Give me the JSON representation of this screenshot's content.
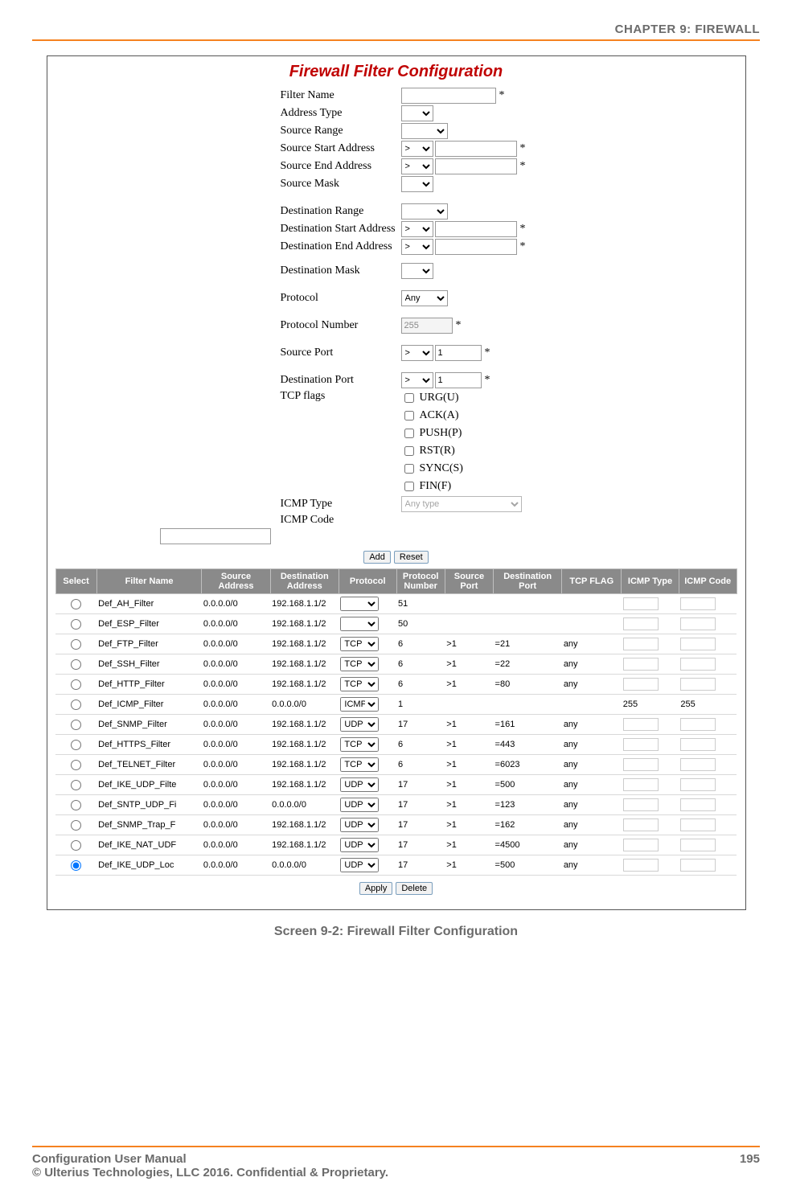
{
  "doc": {
    "chapter_header": "CHAPTER 9: FIREWALL",
    "caption": "Screen 9-2: Firewall Filter Configuration",
    "footer_left_1": "Configuration User Manual",
    "footer_left_2": "© Ulterius Technologies, LLC 2016. Confidential & Proprietary.",
    "page_number": "195"
  },
  "figure": {
    "title": "Firewall Filter Configuration",
    "form": {
      "filter_name_label": "Filter Name",
      "filter_name_value": "",
      "address_type_label": "Address Type",
      "source_range_label": "Source Range",
      "source_start_label": "Source Start Address",
      "source_start_op": ">",
      "source_start_value": "",
      "source_end_label": "Source End Address",
      "source_end_op": ">",
      "source_end_value": "",
      "source_mask_label": "Source Mask",
      "dest_range_label": "Destination Range",
      "dest_start_label": "Destination Start Address",
      "dest_start_op": ">",
      "dest_start_value": "",
      "dest_end_label": "Destination End Address",
      "dest_end_op": ">",
      "dest_end_value": "",
      "dest_mask_label": "Destination Mask",
      "protocol_label": "Protocol",
      "protocol_value": "Any",
      "protocol_number_label": "Protocol Number",
      "protocol_number_value": "255",
      "source_port_label": "Source Port",
      "source_port_op": ">",
      "source_port_value": "1",
      "dest_port_label": "Destination Port",
      "dest_port_op": ">",
      "dest_port_value": "1",
      "tcp_flags_label": "TCP flags",
      "tcp_flags": [
        {
          "key": "urg",
          "label": "URG(U)"
        },
        {
          "key": "ack",
          "label": "ACK(A)"
        },
        {
          "key": "push",
          "label": "PUSH(P)"
        },
        {
          "key": "rst",
          "label": "RST(R)"
        },
        {
          "key": "sync",
          "label": "SYNC(S)"
        },
        {
          "key": "fin",
          "label": "FIN(F)"
        }
      ],
      "icmp_type_label": "ICMP Type",
      "icmp_type_value": "Any type",
      "icmp_code_label": "ICMP Code",
      "icmp_code_value": "",
      "btn_add": "Add",
      "btn_reset": "Reset",
      "btn_apply": "Apply",
      "btn_delete": "Delete"
    },
    "table": {
      "headers": {
        "select": "Select",
        "name": "Filter Name",
        "src": "Source Address",
        "dst": "Destination Address",
        "protocol": "Protocol",
        "protnum": "Protocol Number",
        "sport": "Source Port",
        "dport": "Destination Port",
        "tcpflag": "TCP FLAG",
        "icmptype": "ICMP Type",
        "icmpcode": "ICMP Code"
      },
      "rows": [
        {
          "selected": false,
          "name": "Def_AH_Filter",
          "src": "0.0.0.0/0",
          "dst": "192.168.1.1/2",
          "protocol": "",
          "protnum": "51",
          "sport": "",
          "dport": "",
          "tcpflag": "",
          "icmptype": "",
          "icmpcode": ""
        },
        {
          "selected": false,
          "name": "Def_ESP_Filter",
          "src": "0.0.0.0/0",
          "dst": "192.168.1.1/2",
          "protocol": "",
          "protnum": "50",
          "sport": "",
          "dport": "",
          "tcpflag": "",
          "icmptype": "",
          "icmpcode": ""
        },
        {
          "selected": false,
          "name": "Def_FTP_Filter",
          "src": "0.0.0.0/0",
          "dst": "192.168.1.1/2",
          "protocol": "TCP",
          "protnum": "6",
          "sport": ">1",
          "dport": "=21",
          "tcpflag": "any",
          "icmptype": "",
          "icmpcode": ""
        },
        {
          "selected": false,
          "name": "Def_SSH_Filter",
          "src": "0.0.0.0/0",
          "dst": "192.168.1.1/2",
          "protocol": "TCP",
          "protnum": "6",
          "sport": ">1",
          "dport": "=22",
          "tcpflag": "any",
          "icmptype": "",
          "icmpcode": ""
        },
        {
          "selected": false,
          "name": "Def_HTTP_Filter",
          "src": "0.0.0.0/0",
          "dst": "192.168.1.1/2",
          "protocol": "TCP",
          "protnum": "6",
          "sport": ">1",
          "dport": "=80",
          "tcpflag": "any",
          "icmptype": "",
          "icmpcode": ""
        },
        {
          "selected": false,
          "name": "Def_ICMP_Filter",
          "src": "0.0.0.0/0",
          "dst": "0.0.0.0/0",
          "protocol": "ICMP",
          "protnum": "1",
          "sport": "",
          "dport": "",
          "tcpflag": "",
          "icmptype": "255",
          "icmpcode": "255"
        },
        {
          "selected": false,
          "name": "Def_SNMP_Filter",
          "src": "0.0.0.0/0",
          "dst": "192.168.1.1/2",
          "protocol": "UDP",
          "protnum": "17",
          "sport": ">1",
          "dport": "=161",
          "tcpflag": "any",
          "icmptype": "",
          "icmpcode": ""
        },
        {
          "selected": false,
          "name": "Def_HTTPS_Filter",
          "src": "0.0.0.0/0",
          "dst": "192.168.1.1/2",
          "protocol": "TCP",
          "protnum": "6",
          "sport": ">1",
          "dport": "=443",
          "tcpflag": "any",
          "icmptype": "",
          "icmpcode": ""
        },
        {
          "selected": false,
          "name": "Def_TELNET_Filter",
          "src": "0.0.0.0/0",
          "dst": "192.168.1.1/2",
          "protocol": "TCP",
          "protnum": "6",
          "sport": ">1",
          "dport": "=6023",
          "tcpflag": "any",
          "icmptype": "",
          "icmpcode": ""
        },
        {
          "selected": false,
          "name": "Def_IKE_UDP_Filte",
          "src": "0.0.0.0/0",
          "dst": "192.168.1.1/2",
          "protocol": "UDP",
          "protnum": "17",
          "sport": ">1",
          "dport": "=500",
          "tcpflag": "any",
          "icmptype": "",
          "icmpcode": ""
        },
        {
          "selected": false,
          "name": "Def_SNTP_UDP_Fi",
          "src": "0.0.0.0/0",
          "dst": "0.0.0.0/0",
          "protocol": "UDP",
          "protnum": "17",
          "sport": ">1",
          "dport": "=123",
          "tcpflag": "any",
          "icmptype": "",
          "icmpcode": ""
        },
        {
          "selected": false,
          "name": "Def_SNMP_Trap_F",
          "src": "0.0.0.0/0",
          "dst": "192.168.1.1/2",
          "protocol": "UDP",
          "protnum": "17",
          "sport": ">1",
          "dport": "=162",
          "tcpflag": "any",
          "icmptype": "",
          "icmpcode": ""
        },
        {
          "selected": false,
          "name": "Def_IKE_NAT_UDF",
          "src": "0.0.0.0/0",
          "dst": "192.168.1.1/2",
          "protocol": "UDP",
          "protnum": "17",
          "sport": ">1",
          "dport": "=4500",
          "tcpflag": "any",
          "icmptype": "",
          "icmpcode": ""
        },
        {
          "selected": true,
          "name": "Def_IKE_UDP_Loc",
          "src": "0.0.0.0/0",
          "dst": "0.0.0.0/0",
          "protocol": "UDP",
          "protnum": "17",
          "sport": ">1",
          "dport": "=500",
          "tcpflag": "any",
          "icmptype": "",
          "icmpcode": ""
        }
      ]
    }
  }
}
